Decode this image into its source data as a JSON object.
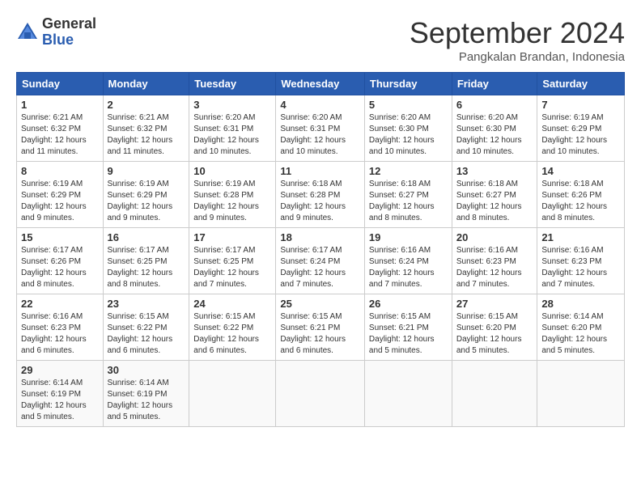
{
  "header": {
    "logo_general": "General",
    "logo_blue": "Blue",
    "month_title": "September 2024",
    "location": "Pangkalan Brandan, Indonesia"
  },
  "weekdays": [
    "Sunday",
    "Monday",
    "Tuesday",
    "Wednesday",
    "Thursday",
    "Friday",
    "Saturday"
  ],
  "weeks": [
    [
      {
        "day": "1",
        "sunrise": "6:21 AM",
        "sunset": "6:32 PM",
        "daylight": "12 hours and 11 minutes."
      },
      {
        "day": "2",
        "sunrise": "6:21 AM",
        "sunset": "6:32 PM",
        "daylight": "12 hours and 11 minutes."
      },
      {
        "day": "3",
        "sunrise": "6:20 AM",
        "sunset": "6:31 PM",
        "daylight": "12 hours and 10 minutes."
      },
      {
        "day": "4",
        "sunrise": "6:20 AM",
        "sunset": "6:31 PM",
        "daylight": "12 hours and 10 minutes."
      },
      {
        "day": "5",
        "sunrise": "6:20 AM",
        "sunset": "6:30 PM",
        "daylight": "12 hours and 10 minutes."
      },
      {
        "day": "6",
        "sunrise": "6:20 AM",
        "sunset": "6:30 PM",
        "daylight": "12 hours and 10 minutes."
      },
      {
        "day": "7",
        "sunrise": "6:19 AM",
        "sunset": "6:29 PM",
        "daylight": "12 hours and 10 minutes."
      }
    ],
    [
      {
        "day": "8",
        "sunrise": "6:19 AM",
        "sunset": "6:29 PM",
        "daylight": "12 hours and 9 minutes."
      },
      {
        "day": "9",
        "sunrise": "6:19 AM",
        "sunset": "6:29 PM",
        "daylight": "12 hours and 9 minutes."
      },
      {
        "day": "10",
        "sunrise": "6:19 AM",
        "sunset": "6:28 PM",
        "daylight": "12 hours and 9 minutes."
      },
      {
        "day": "11",
        "sunrise": "6:18 AM",
        "sunset": "6:28 PM",
        "daylight": "12 hours and 9 minutes."
      },
      {
        "day": "12",
        "sunrise": "6:18 AM",
        "sunset": "6:27 PM",
        "daylight": "12 hours and 8 minutes."
      },
      {
        "day": "13",
        "sunrise": "6:18 AM",
        "sunset": "6:27 PM",
        "daylight": "12 hours and 8 minutes."
      },
      {
        "day": "14",
        "sunrise": "6:18 AM",
        "sunset": "6:26 PM",
        "daylight": "12 hours and 8 minutes."
      }
    ],
    [
      {
        "day": "15",
        "sunrise": "6:17 AM",
        "sunset": "6:26 PM",
        "daylight": "12 hours and 8 minutes."
      },
      {
        "day": "16",
        "sunrise": "6:17 AM",
        "sunset": "6:25 PM",
        "daylight": "12 hours and 8 minutes."
      },
      {
        "day": "17",
        "sunrise": "6:17 AM",
        "sunset": "6:25 PM",
        "daylight": "12 hours and 7 minutes."
      },
      {
        "day": "18",
        "sunrise": "6:17 AM",
        "sunset": "6:24 PM",
        "daylight": "12 hours and 7 minutes."
      },
      {
        "day": "19",
        "sunrise": "6:16 AM",
        "sunset": "6:24 PM",
        "daylight": "12 hours and 7 minutes."
      },
      {
        "day": "20",
        "sunrise": "6:16 AM",
        "sunset": "6:23 PM",
        "daylight": "12 hours and 7 minutes."
      },
      {
        "day": "21",
        "sunrise": "6:16 AM",
        "sunset": "6:23 PM",
        "daylight": "12 hours and 7 minutes."
      }
    ],
    [
      {
        "day": "22",
        "sunrise": "6:16 AM",
        "sunset": "6:23 PM",
        "daylight": "12 hours and 6 minutes."
      },
      {
        "day": "23",
        "sunrise": "6:15 AM",
        "sunset": "6:22 PM",
        "daylight": "12 hours and 6 minutes."
      },
      {
        "day": "24",
        "sunrise": "6:15 AM",
        "sunset": "6:22 PM",
        "daylight": "12 hours and 6 minutes."
      },
      {
        "day": "25",
        "sunrise": "6:15 AM",
        "sunset": "6:21 PM",
        "daylight": "12 hours and 6 minutes."
      },
      {
        "day": "26",
        "sunrise": "6:15 AM",
        "sunset": "6:21 PM",
        "daylight": "12 hours and 5 minutes."
      },
      {
        "day": "27",
        "sunrise": "6:15 AM",
        "sunset": "6:20 PM",
        "daylight": "12 hours and 5 minutes."
      },
      {
        "day": "28",
        "sunrise": "6:14 AM",
        "sunset": "6:20 PM",
        "daylight": "12 hours and 5 minutes."
      }
    ],
    [
      {
        "day": "29",
        "sunrise": "6:14 AM",
        "sunset": "6:19 PM",
        "daylight": "12 hours and 5 minutes."
      },
      {
        "day": "30",
        "sunrise": "6:14 AM",
        "sunset": "6:19 PM",
        "daylight": "12 hours and 5 minutes."
      },
      null,
      null,
      null,
      null,
      null
    ]
  ]
}
